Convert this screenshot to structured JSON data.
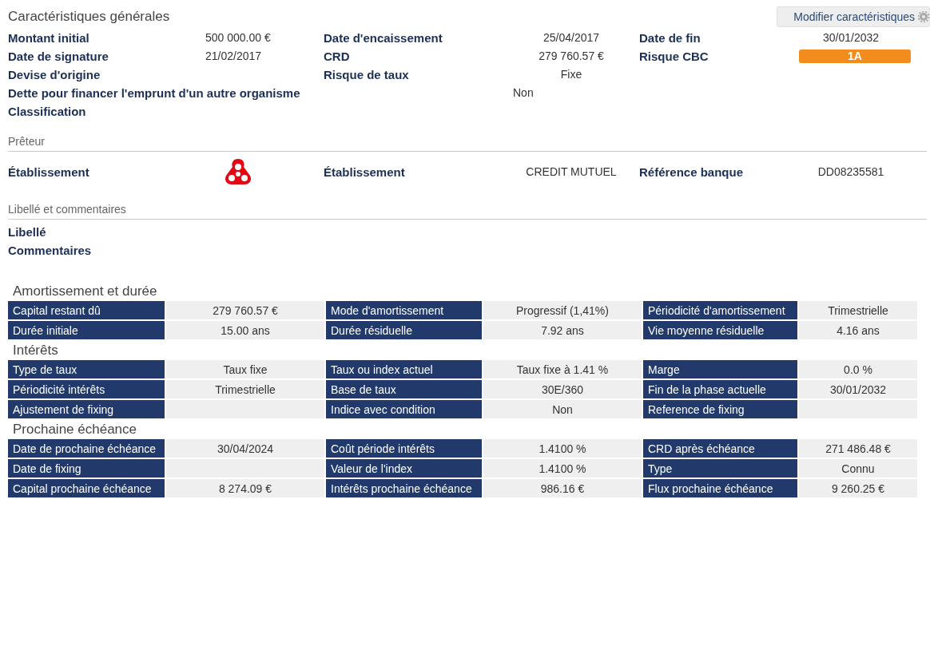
{
  "general": {
    "title": "Caractéristiques générales",
    "edit_button": "Modifier caractéristiques",
    "rows": [
      [
        {
          "label": "Montant initial",
          "value": "500 000.00 €"
        },
        {
          "label": "Date d'encaissement",
          "value": "25/04/2017"
        },
        {
          "label": "Date de fin",
          "value": "30/01/2032"
        }
      ],
      [
        {
          "label": "Date de signature",
          "value": "21/02/2017"
        },
        {
          "label": "CRD",
          "value": "279 760.57 €"
        },
        {
          "label": "Risque CBC",
          "value": "1A",
          "kind": "badge"
        }
      ],
      [
        {
          "label": "Devise d'origine"
        },
        {
          "label": "Risque de taux",
          "value": "Fixe"
        }
      ],
      [
        {
          "label": "Dette pour financer l'emprunt d'un autre organisme",
          "value": "Non",
          "kind": "wide"
        }
      ],
      [
        {
          "label": "Classification"
        }
      ]
    ]
  },
  "lender": {
    "title": "Prêteur",
    "pairs": [
      {
        "label": "Établissement",
        "kind": "logo"
      },
      {
        "label": "Établissement",
        "value": "CREDIT MUTUEL"
      },
      {
        "label": "Référence banque",
        "value": "DD08235581"
      }
    ]
  },
  "notes": {
    "title": "Libellé et commentaires",
    "labels": [
      "Libellé",
      "Commentaires"
    ]
  },
  "tables": [
    {
      "title": "Amortissement et durée",
      "rows": [
        [
          {
            "label": "Capital restant dû",
            "value": "279 760.57 €"
          },
          {
            "label": "Mode d'amortissement",
            "value": "Progressif (1,41%)"
          },
          {
            "label": "Périodicité d'amortissement",
            "value": "Trimestrielle"
          }
        ],
        [
          {
            "label": "Durée initiale",
            "value": "15.00 ans"
          },
          {
            "label": "Durée résiduelle",
            "value": "7.92 ans"
          },
          {
            "label": "Vie moyenne résiduelle",
            "value": "4.16 ans"
          }
        ]
      ]
    },
    {
      "title": "Intérêts",
      "rows": [
        [
          {
            "label": "Type de taux",
            "value": "Taux fixe"
          },
          {
            "label": "Taux ou index actuel",
            "value": "Taux fixe à 1.41 %"
          },
          {
            "label": "Marge",
            "value": "0.0 %"
          }
        ],
        [
          {
            "label": "Périodicité intérêts",
            "value": "Trimestrielle"
          },
          {
            "label": "Base de taux",
            "value": "30E/360"
          },
          {
            "label": "Fin de la phase actuelle",
            "value": "30/01/2032"
          }
        ],
        [
          {
            "label": "Ajustement de fixing"
          },
          {
            "label": "Indice avec condition",
            "value": "Non"
          },
          {
            "label": "Reference de fixing"
          }
        ]
      ]
    },
    {
      "title": "Prochaine échéance",
      "rows": [
        [
          {
            "label": "Date de prochaine échéance",
            "value": "30/04/2024"
          },
          {
            "label": "Coût période intérêts",
            "value": "1.4100 %"
          },
          {
            "label": "CRD après échéance",
            "value": "271 486.48 €"
          }
        ],
        [
          {
            "label": "Date de fixing"
          },
          {
            "label": "Valeur de l'index",
            "value": "1.4100 %"
          },
          {
            "label": "Type",
            "value": "Connu"
          }
        ],
        [
          {
            "label": "Capital prochaine échéance",
            "value": "8 274.09 €"
          },
          {
            "label": "Intérêts prochaine échéance",
            "value": "986.16 €"
          },
          {
            "label": "Flux prochaine échéance",
            "value": "9 260.25 €"
          }
        ]
      ]
    }
  ]
}
